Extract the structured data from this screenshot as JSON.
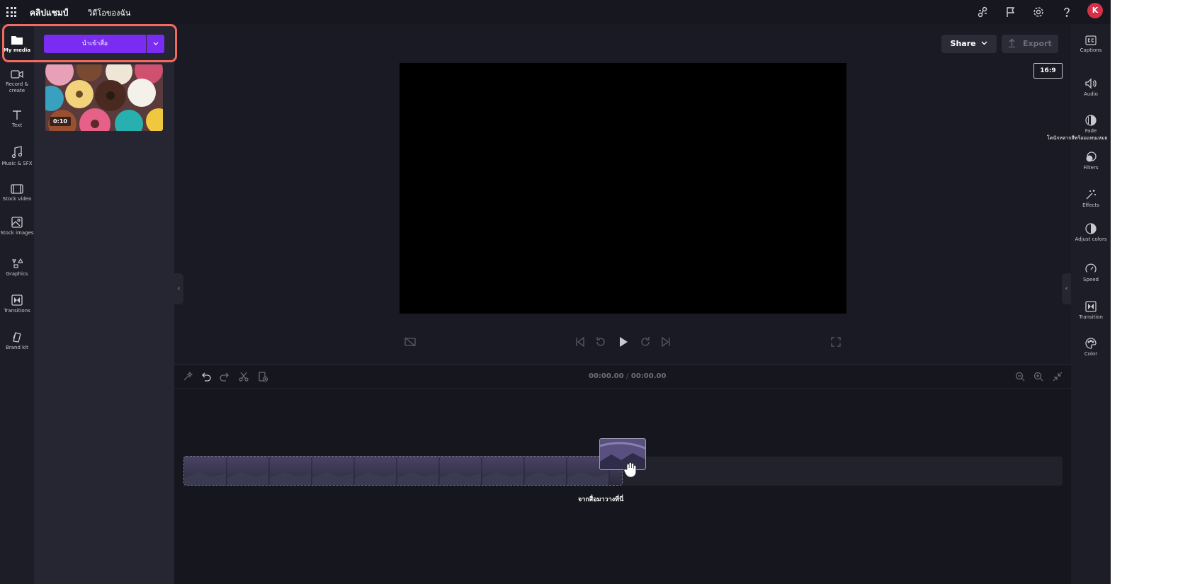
{
  "header": {
    "app_name": "คลิปแชมป์",
    "nav_videos": "วิดีโอของฉัน",
    "avatar_initial": "K"
  },
  "left_rail": {
    "items": [
      {
        "label": "My media",
        "icon": "folder-icon"
      },
      {
        "label": "Record & create",
        "icon": "camera-icon"
      },
      {
        "label": "Text",
        "icon": "text-icon"
      },
      {
        "label": "Music & SFX",
        "icon": "music-icon"
      },
      {
        "label": "Stock video",
        "icon": "film-icon"
      },
      {
        "label": "Stock images",
        "icon": "image-icon"
      },
      {
        "label": "Graphics",
        "icon": "shapes-icon"
      },
      {
        "label": "Transitions",
        "icon": "transition-icon"
      },
      {
        "label": "Brand kit",
        "icon": "brand-icon"
      }
    ]
  },
  "media_panel": {
    "import_label": "นำเข้าสื่อ",
    "media_items": [
      {
        "duration": "0:10"
      }
    ]
  },
  "preview": {
    "share_label": "Share",
    "export_label": "Export",
    "aspect_ratio": "16:9"
  },
  "timeline": {
    "current_time": "00:00.00",
    "separator": "/",
    "total_time": "00:00.00",
    "drop_label": "จากสื่อมาวางที่นี่"
  },
  "right_rail": {
    "items": [
      {
        "label": "Captions",
        "icon": "captions-icon"
      },
      {
        "label": "Audio",
        "icon": "speaker-icon"
      },
      {
        "label": "Fade",
        "icon": "fade-icon"
      },
      {
        "label": "Filters",
        "icon": "filters-icon"
      },
      {
        "label": "Effects",
        "icon": "wand-icon"
      },
      {
        "label": "Adjust colors",
        "icon": "contrast-icon"
      },
      {
        "label": "Speed",
        "icon": "speedometer-icon"
      },
      {
        "label": "Transition",
        "icon": "transition-icon"
      },
      {
        "label": "Color",
        "icon": "palette-icon"
      }
    ],
    "tooltip": "โคนักหลากสีพร้อมแทนเหมย"
  },
  "colors": {
    "accent": "#7b2cf2",
    "highlight": "#f26b5e",
    "avatar": "#d3324a"
  }
}
